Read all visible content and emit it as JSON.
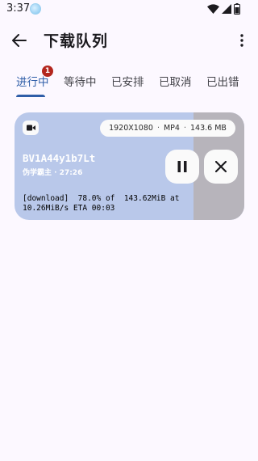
{
  "status_bar": {
    "time": "3:37"
  },
  "app_bar": {
    "title": "下载队列"
  },
  "tabs": [
    {
      "label": "进行中",
      "badge": "1",
      "active": true
    },
    {
      "label": "等待中"
    },
    {
      "label": "已安排"
    },
    {
      "label": "已取消"
    },
    {
      "label": "已出错"
    }
  ],
  "download": {
    "resolution": "1920X1080",
    "format": "MP4",
    "size": "143.6 MB",
    "separator": "·",
    "title": "BV1A44y1b7Lt",
    "subtitle": "伪学霸主 · 27:26",
    "log_line_1": "[download]  78.0% of  143.62MiB at",
    "log_line_2": "10.26MiB/s ETA 00:03",
    "progress": 0.78
  },
  "colors": {
    "accent": "#2f5ea8",
    "card_progress": "#b9c8ea",
    "card_remaining": "#b7b4bb",
    "badge": "#b3261e"
  }
}
